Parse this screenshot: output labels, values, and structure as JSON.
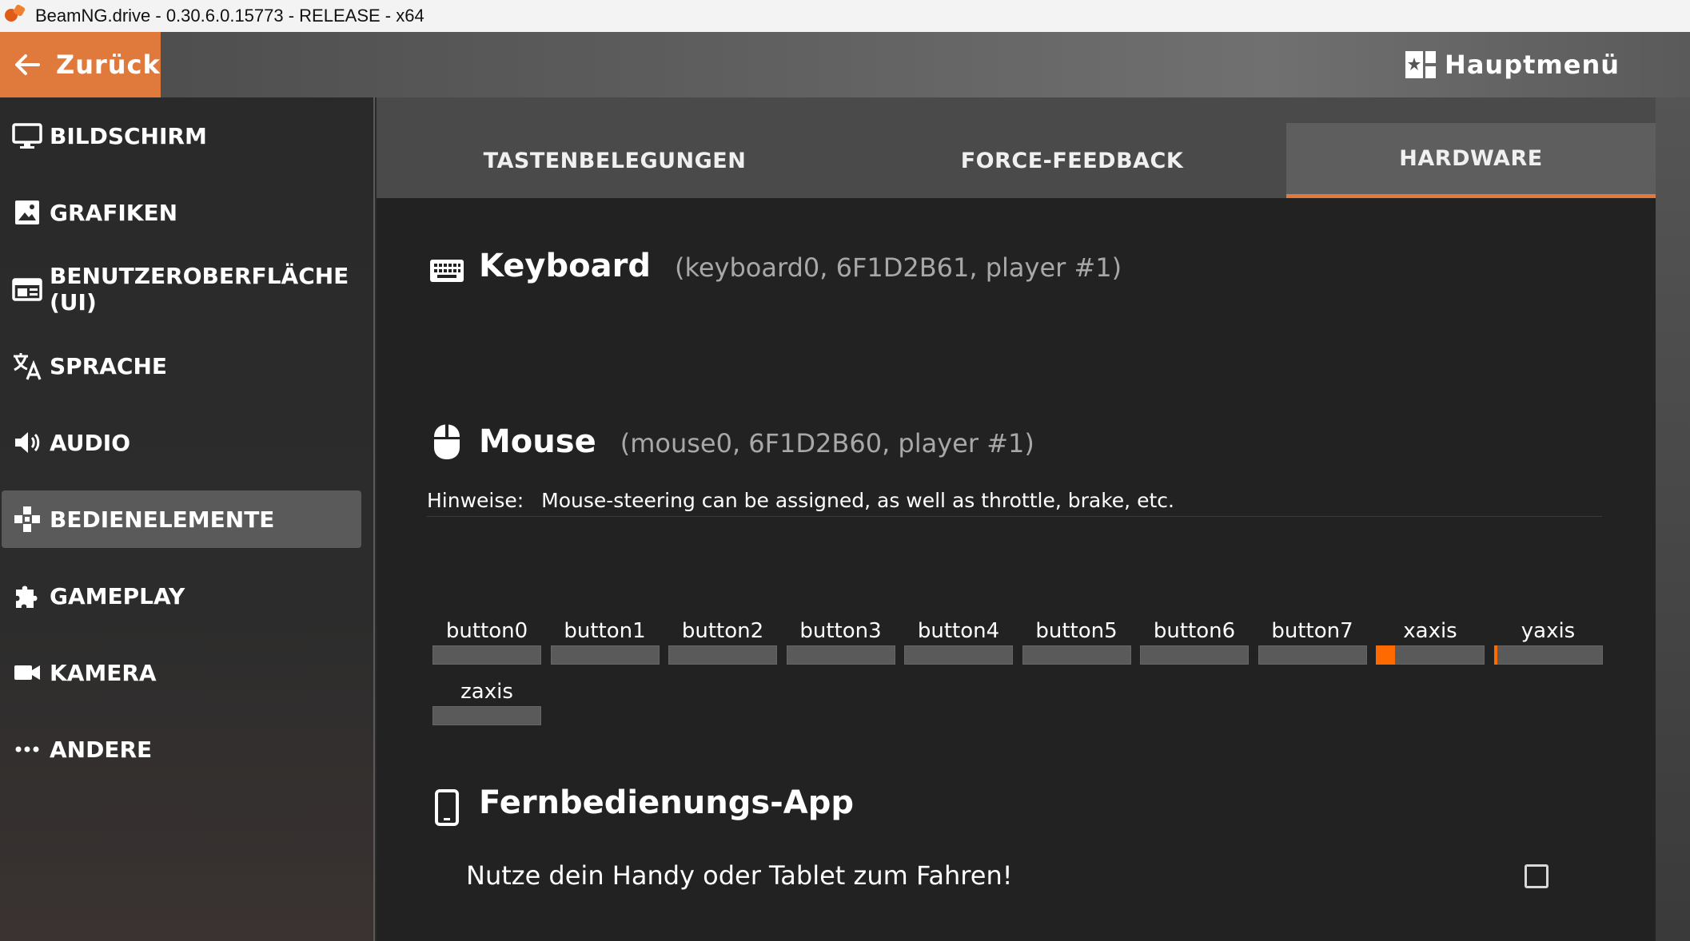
{
  "window": {
    "title": "BeamNG.drive - 0.30.6.0.15773 - RELEASE - x64"
  },
  "topbar": {
    "back_label": "Zurück",
    "mainmenu_label": "Hauptmenü"
  },
  "sidebar": {
    "items": [
      {
        "label": "BILDSCHIRM",
        "icon": "monitor-icon"
      },
      {
        "label": "GRAFIKEN",
        "icon": "image-icon"
      },
      {
        "label": "BENUTZEROBERFLÄCHE (UI)",
        "icon": "ui-icon"
      },
      {
        "label": "SPRACHE",
        "icon": "translate-icon"
      },
      {
        "label": "AUDIO",
        "icon": "speaker-icon"
      },
      {
        "label": "BEDIENELEMENTE",
        "icon": "controls-icon",
        "active": true
      },
      {
        "label": "GAMEPLAY",
        "icon": "puzzle-icon"
      },
      {
        "label": "KAMERA",
        "icon": "camera-icon"
      },
      {
        "label": "ANDERE",
        "icon": "more-icon"
      }
    ]
  },
  "tabs": [
    {
      "label": "TASTENBELEGUNGEN"
    },
    {
      "label": "FORCE-FEEDBACK"
    },
    {
      "label": "HARDWARE",
      "active": true
    }
  ],
  "devices": {
    "keyboard": {
      "title": "Keyboard",
      "info": "(keyboard0, 6F1D2B61, player #1)"
    },
    "mouse": {
      "title": "Mouse",
      "info": "(mouse0, 6F1D2B60, player #1)",
      "hint_label": "Hinweise:",
      "hint_text": "Mouse-steering can be assigned, as well as throttle, brake, etc.",
      "inputs": [
        {
          "label": "button0",
          "value": 0
        },
        {
          "label": "button1",
          "value": 0
        },
        {
          "label": "button2",
          "value": 0
        },
        {
          "label": "button3",
          "value": 0
        },
        {
          "label": "button4",
          "value": 0
        },
        {
          "label": "button5",
          "value": 0
        },
        {
          "label": "button6",
          "value": 0
        },
        {
          "label": "button7",
          "value": 0
        },
        {
          "label": "xaxis",
          "value": 0.18
        },
        {
          "label": "yaxis",
          "value": 0.03
        },
        {
          "label": "zaxis",
          "value": 0
        }
      ]
    },
    "remote": {
      "title": "Fernbedienungs-App",
      "option_text": "Nutze dein Handy oder Tablet zum Fahren!",
      "checked": false
    }
  },
  "colors": {
    "accent": "#e07a3c",
    "bar_fill": "#ff6a00",
    "active_item": "#5a5a5a"
  }
}
